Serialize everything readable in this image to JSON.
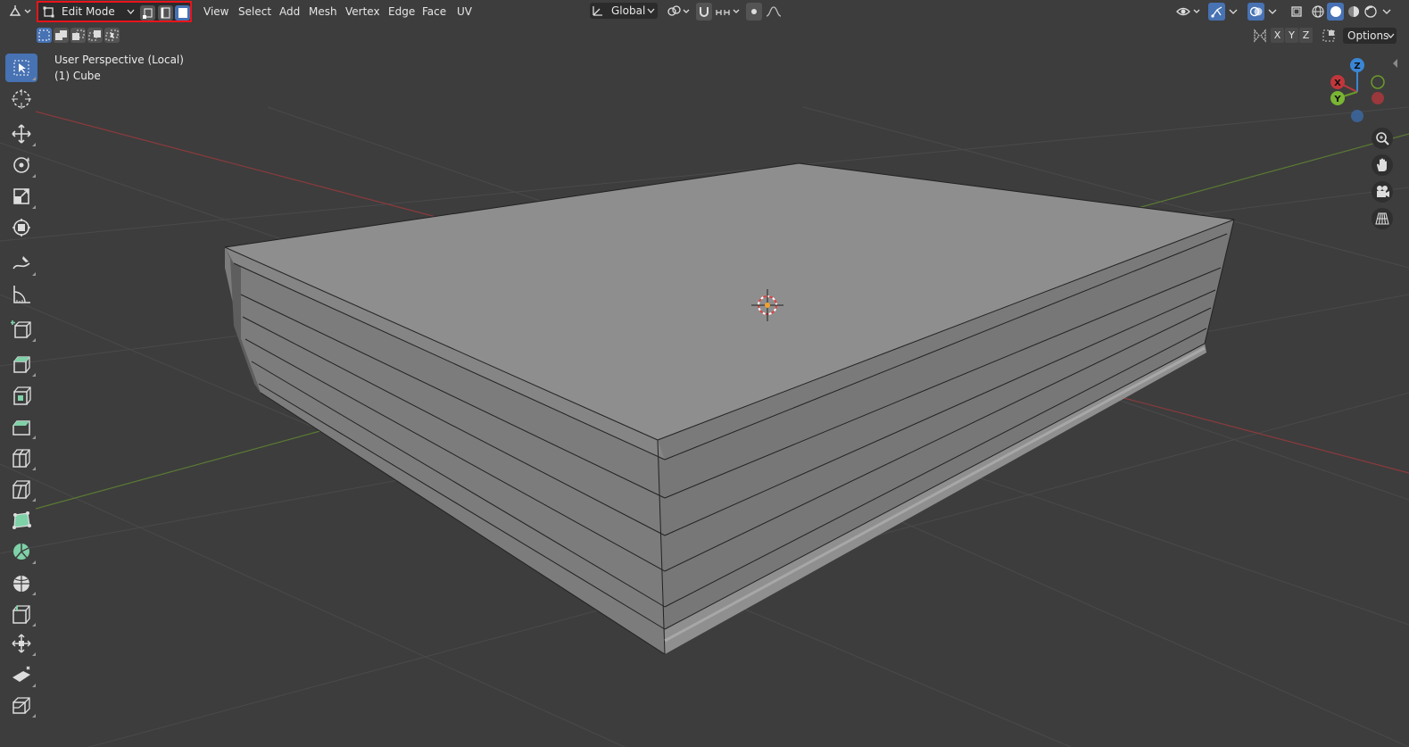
{
  "header": {
    "editor_type_icon": "view3d-icon",
    "mode": {
      "label": "Edit Mode",
      "icon": "edit-mode-icon"
    },
    "select_modes": [
      {
        "name": "vertex-select-icon",
        "active": false
      },
      {
        "name": "edge-select-icon",
        "active": false
      },
      {
        "name": "face-select-icon",
        "active": true
      }
    ],
    "menus": [
      "View",
      "Select",
      "Add",
      "Mesh",
      "Vertex",
      "Edge",
      "Face",
      "UV"
    ],
    "transform_orientation": "Global",
    "options_label": "Options",
    "axis_buttons": [
      "X",
      "Y",
      "Z"
    ]
  },
  "overlay": {
    "view_name": "User Perspective (Local)",
    "object_name": "(1) Cube"
  },
  "gizmo": {
    "x": "X",
    "y": "Y",
    "z": "Z"
  },
  "toolbar": [
    "select-box-icon",
    "cursor-icon",
    "move-icon",
    "rotate-icon",
    "scale-icon",
    "transform-icon",
    "annotate-icon",
    "measure-icon",
    "add-cube-icon",
    "extrude-icon",
    "inset-icon",
    "bevel-icon",
    "loop-cut-icon",
    "knife-icon",
    "poly-build-icon",
    "spin-icon",
    "smooth-icon",
    "edge-slide-icon",
    "shrink-fatten-icon",
    "shear-icon",
    "rip-icon"
  ],
  "colors": {
    "background": "#3d3d3d",
    "active_blue": "#4772b3",
    "highlight_red": "#e8141b",
    "x_axis": "#c2363b",
    "y_axis": "#6b9b2a",
    "z_axis": "#3a86d6"
  }
}
